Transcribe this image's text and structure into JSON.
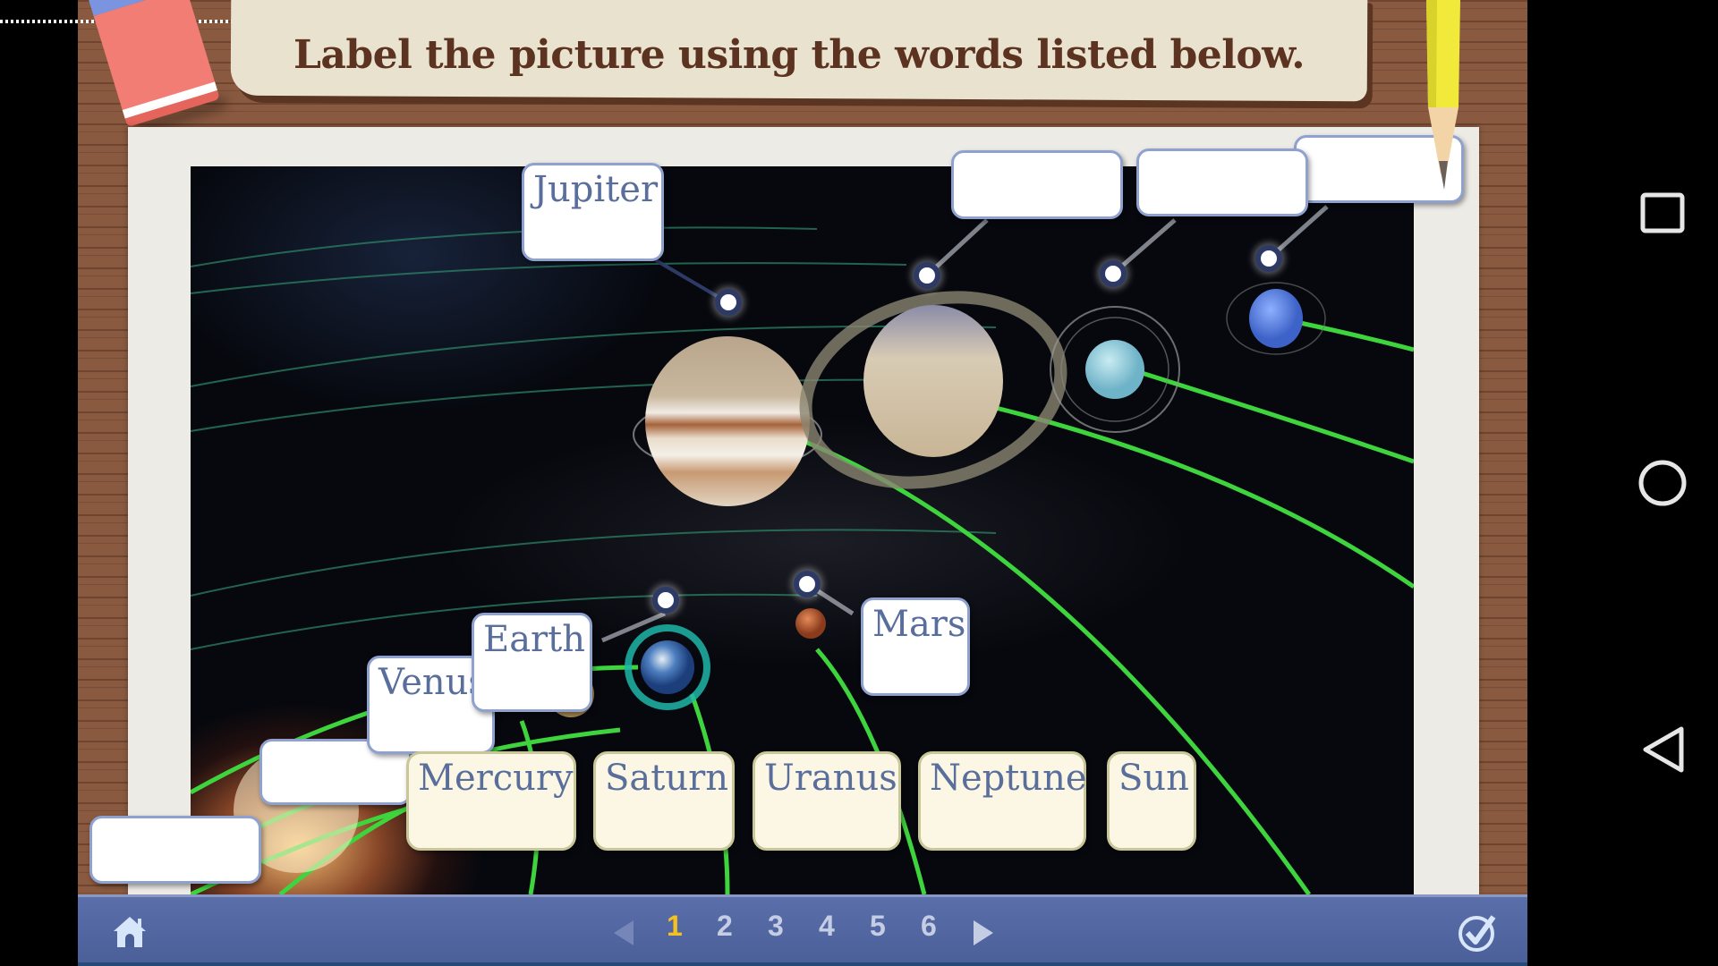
{
  "title": "Label the picture using the words listed below.",
  "diagram": {
    "placed_labels": [
      {
        "id": "jupiter",
        "text": "Jupiter"
      },
      {
        "id": "mars",
        "text": "Mars"
      },
      {
        "id": "earth",
        "text": "Earth"
      },
      {
        "id": "venus",
        "text": "Venus"
      }
    ],
    "empty_slots": [
      "saturn-slot",
      "uranus-slot",
      "neptune-slot",
      "mercury-slot",
      "sun-slot"
    ]
  },
  "word_bank": [
    "Mercury",
    "Saturn",
    "Uranus",
    "Neptune",
    "Sun"
  ],
  "pagination": {
    "pages": [
      "1",
      "2",
      "3",
      "4",
      "5",
      "6"
    ],
    "current": "1",
    "prev_enabled": false,
    "next_enabled": true
  },
  "icons": {
    "home": "home-icon",
    "check": "check-circle-icon",
    "prev": "triangle-left-icon",
    "next": "triangle-right-icon",
    "recents": "square-icon",
    "android_home": "circle-icon",
    "back": "triangle-back-icon"
  },
  "colors": {
    "board": "#8a5a40",
    "banner": "#e9e2cf",
    "title_text": "#5c3320",
    "label_text": "#5a6e9c",
    "label_border": "#8fa1cf",
    "card_bg": "#fbf7e4",
    "bar": "#5167a3",
    "active_page": "#f5c022",
    "orbit_green": "#3ed43e"
  }
}
